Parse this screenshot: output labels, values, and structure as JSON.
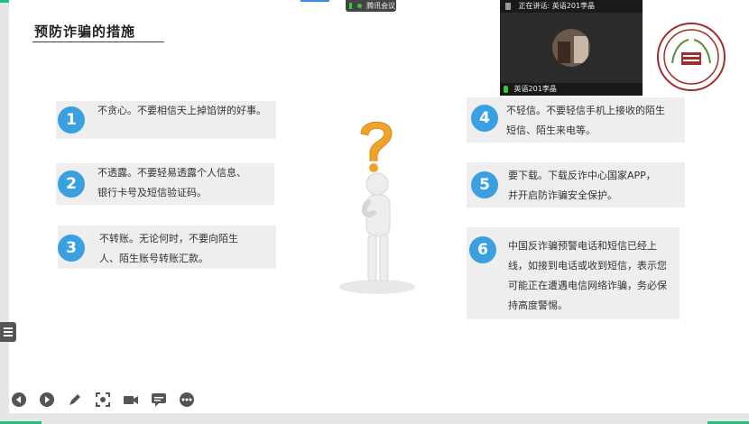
{
  "meeting": {
    "app_label": "腾讯会议",
    "speaking_label": "正在讲话: 英语201李晶",
    "participant_name": "英语201李晶"
  },
  "slide": {
    "title": "预防诈骗的措施",
    "measures": [
      {
        "number": "1",
        "text": "不贪心。不要相信天上掉馅饼的好事。"
      },
      {
        "number": "2",
        "text": "不透露。不要轻易透露个人信息、银行卡号及短信验证码。"
      },
      {
        "number": "3",
        "text": "不转账。无论何时，不要向陌生人、陌生账号转账汇款。"
      },
      {
        "number": "4",
        "text": "不轻信。不要轻信手机上接收的陌生短信、陌生来电等。"
      },
      {
        "number": "5",
        "text": "要下载。下载反诈中心国家APP，并开启防诈骗安全保护。"
      },
      {
        "number": "6",
        "text": "中国反诈骗预警电话和短信已经上线，如接到电话或收到短信，表示您可能正在遭遇电信网络诈骗，务必保持高度警惕。"
      }
    ]
  },
  "toolbar": {
    "icons": [
      "prev-icon",
      "next-icon",
      "pen-icon",
      "screenshot-icon",
      "camera-icon",
      "comment-icon",
      "more-icon"
    ]
  },
  "colors": {
    "badge": "#3aa0e0",
    "card": "#eeeeee",
    "accent_green": "#22c07a"
  }
}
